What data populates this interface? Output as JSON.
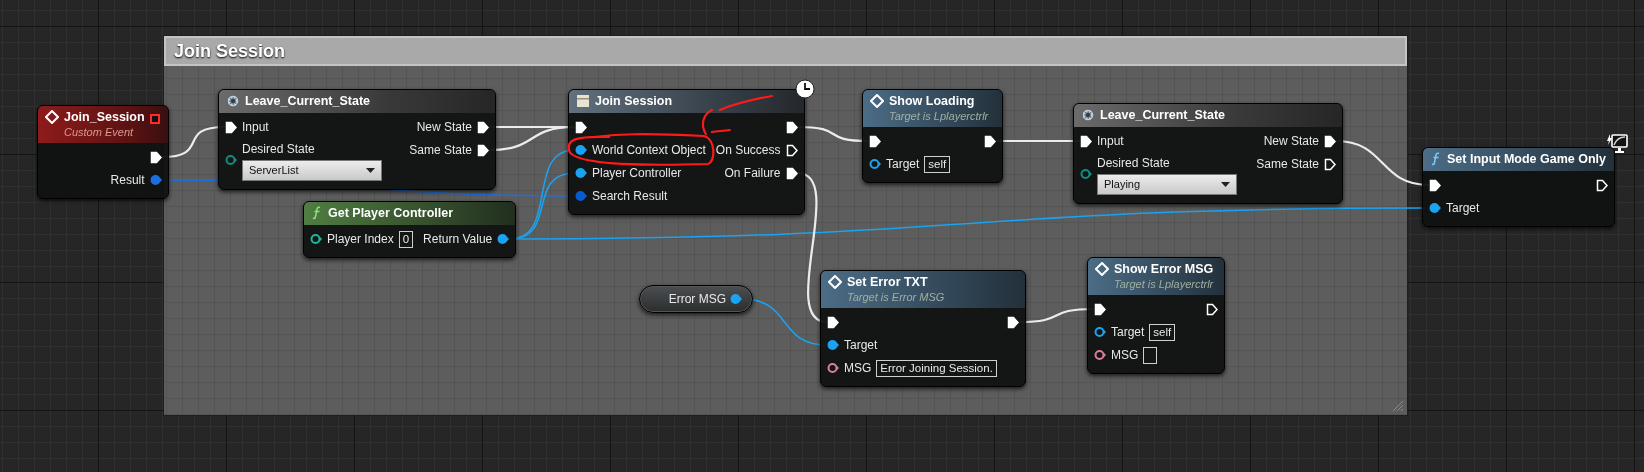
{
  "comment": {
    "title": "Join Session"
  },
  "nodes": [
    {
      "kind": "event",
      "title": "Join_Session",
      "subtitle": "Custom Event",
      "outputs": [
        {
          "kind": "exec",
          "connected": true
        },
        {
          "kind": "data",
          "label": "Result",
          "color": "#1d6fe0",
          "connected": true
        }
      ]
    },
    {
      "kind": "macro",
      "title": "Leave_Current_State",
      "inputs": [
        {
          "kind": "exec",
          "label": "Input",
          "connected": true
        },
        {
          "kind": "data",
          "label": "Desired State",
          "color": "#0f8f80",
          "connected": false,
          "dropdown": "ServerList"
        }
      ],
      "outputs": [
        {
          "kind": "exec",
          "label": "New State",
          "connected": true
        },
        {
          "kind": "exec",
          "label": "Same State",
          "connected": true
        }
      ]
    },
    {
      "kind": "latent",
      "title": "Join Session",
      "inputs": [
        {
          "kind": "exec",
          "connected": true
        },
        {
          "kind": "data",
          "label": "World Context Object",
          "color": "#1aa3f0",
          "connected": true
        },
        {
          "kind": "data",
          "label": "Player Controller",
          "color": "#1aa3f0",
          "connected": true
        },
        {
          "kind": "data",
          "label": "Search Result",
          "color": "#0a5bd0",
          "connected": true
        }
      ],
      "outputs": [
        {
          "kind": "exec",
          "connected": true
        },
        {
          "kind": "exec",
          "label": "On Success",
          "connected": false
        },
        {
          "kind": "exec",
          "label": "On Failure",
          "connected": true
        }
      ]
    },
    {
      "kind": "call_event",
      "title": "Show Loading",
      "subtitle": "Target is Lplayerctrlr",
      "inputs": [
        {
          "kind": "exec",
          "connected": true
        },
        {
          "kind": "data",
          "label": "Target",
          "color": "#1aa3f0",
          "connected": false,
          "value": "self"
        }
      ],
      "outputs": [
        {
          "kind": "exec",
          "connected": true
        }
      ]
    },
    {
      "kind": "macro",
      "title": "Leave_Current_State",
      "inputs": [
        {
          "kind": "exec",
          "label": "Input",
          "connected": true
        },
        {
          "kind": "data",
          "label": "Desired State",
          "color": "#0f8f80",
          "connected": false,
          "dropdown": "Playing"
        }
      ],
      "outputs": [
        {
          "kind": "exec",
          "label": "New State",
          "connected": true
        },
        {
          "kind": "exec",
          "label": "Same State",
          "connected": false
        }
      ]
    },
    {
      "kind": "function",
      "title": "Set Input Mode Game Only",
      "client_only": true,
      "inputs": [
        {
          "kind": "exec",
          "connected": true
        },
        {
          "kind": "data",
          "label": "Target",
          "color": "#1aa3f0",
          "connected": true
        }
      ],
      "outputs": [
        {
          "kind": "exec",
          "connected": false
        }
      ]
    },
    {
      "kind": "pure",
      "title": "Get Player Controller",
      "inputs": [
        {
          "kind": "data",
          "label": "Player Index",
          "color": "#1fb89a",
          "connected": false,
          "value": "0"
        }
      ],
      "outputs": [
        {
          "kind": "data",
          "label": "Return Value",
          "color": "#1aa3f0",
          "connected": true
        }
      ]
    },
    {
      "kind": "variable",
      "outputs": [
        {
          "kind": "data",
          "label": "Error MSG",
          "color": "#1aa3f0",
          "connected": true
        }
      ]
    },
    {
      "kind": "call_event",
      "title": "Set Error TXT",
      "subtitle": "Target is Error MSG",
      "inputs": [
        {
          "kind": "exec",
          "connected": true
        },
        {
          "kind": "data",
          "label": "Target",
          "color": "#1aa3f0",
          "connected": true
        },
        {
          "kind": "data",
          "label": "MSG",
          "color": "#d77f9c",
          "connected": false,
          "value": "Error Joining Session."
        }
      ],
      "outputs": [
        {
          "kind": "exec",
          "connected": true
        }
      ]
    },
    {
      "kind": "call_event",
      "title": "Show Error MSG",
      "subtitle": "Target is Lplayerctrlr",
      "inputs": [
        {
          "kind": "exec",
          "connected": true
        },
        {
          "kind": "data",
          "label": "Target",
          "color": "#1aa3f0",
          "connected": false,
          "value": "self"
        },
        {
          "kind": "data",
          "label": "MSG",
          "color": "#d77f9c",
          "connected": false,
          "empty_field": true
        }
      ],
      "outputs": [
        {
          "kind": "exec",
          "connected": false
        }
      ]
    }
  ]
}
